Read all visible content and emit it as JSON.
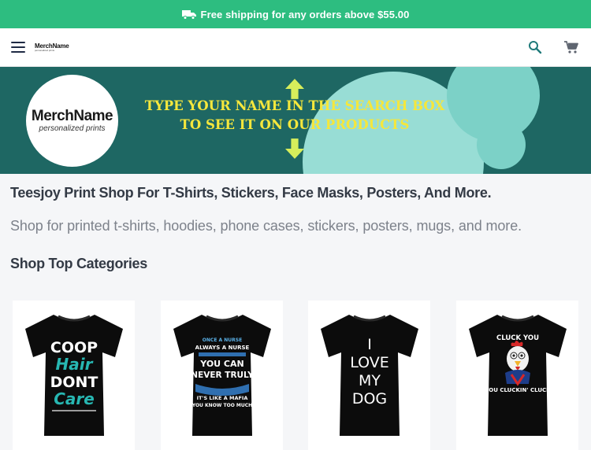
{
  "promo": {
    "text": "Free shipping for any orders above $55.00",
    "icon": "truck-icon"
  },
  "header": {
    "logo": {
      "main": "MerchName",
      "tagline": "personalized prints"
    },
    "icons": [
      "menu-icon",
      "search-icon",
      "cart-icon"
    ]
  },
  "banner": {
    "logo": {
      "main": "MerchName",
      "tagline": "personalized prints"
    },
    "line1": "TYPE YOUR NAME IN THE SEARCH BOX",
    "line2": "TO SEE IT ON OUR PRODUCTS"
  },
  "main": {
    "title": "Teesjoy Print Shop For T-Shirts, Stickers, Face Masks, Posters, And More.",
    "description": "Shop for printed t-shirts, hoodies, phone cases, stickers, posters, mugs, and more.",
    "section_title": "Shop Top Categories"
  },
  "products": [
    {
      "lines": [
        "COOP",
        "Hair",
        "DONT",
        "Care"
      ]
    },
    {
      "lines": [
        "ONCE A NURSE",
        "ALWAYS A NURSE",
        "YOU CAN",
        "NEVER TRULY",
        "IT'S LIKE A MAFIA",
        "YOU KNOW TOO MUCH"
      ]
    },
    {
      "lines": [
        "I",
        "LOVE",
        "MY",
        "DOG"
      ]
    },
    {
      "lines": [
        "CLUCK YOU",
        "YOU CLUCKIN' CLUCK"
      ]
    }
  ],
  "colors": {
    "promo": "#2dbd80",
    "banner_bg": "#1e6763",
    "banner_text": "#f5e73c",
    "accent": "#e6b21a",
    "teal": "#98ddd5"
  }
}
